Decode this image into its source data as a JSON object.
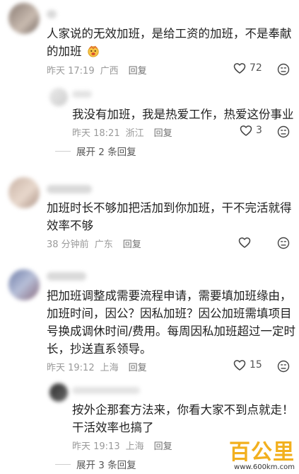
{
  "watermark": {
    "main": "百公里",
    "sub": "www.600km.com"
  },
  "comments": [
    {
      "line1": "人家说的无效加班，是给工资的加班，不是奉献",
      "line2": "的加班",
      "time": "昨天 17:19",
      "location": "广西",
      "reply": "回复",
      "likes": "72",
      "sub": {
        "line1": "我没有加班，我是热爱工作，热爱这份事业",
        "time": "昨天 18:21",
        "location": "浙江",
        "reply": "回复",
        "likes": "3"
      },
      "expand": "展开 2 条回复"
    },
    {
      "line1": "加班时长不够加把活加到你加班，干不完活就得",
      "line2": "效率不够",
      "time": "38 分钟前",
      "location": "广东",
      "reply": "回复"
    },
    {
      "line1": "把加班调整成需要流程申请，需要填加班缘由，",
      "line2": "加班时间，因公？因私加班？因公加班需填项目",
      "line3": "号换成调休时间/费用。每周因私加班超过一定时",
      "line4": "长，抄送直系领导。",
      "time": "昨天 19:12",
      "location": "上海",
      "reply": "回复",
      "likes": "15",
      "sub": {
        "line1": "按外企那套方法来，你看大家不到点就走！",
        "line2": "干活效率也搞了",
        "time": "昨天 19:13",
        "location": "上海",
        "reply": "回复"
      },
      "expand": "展开 3 条回复"
    }
  ]
}
